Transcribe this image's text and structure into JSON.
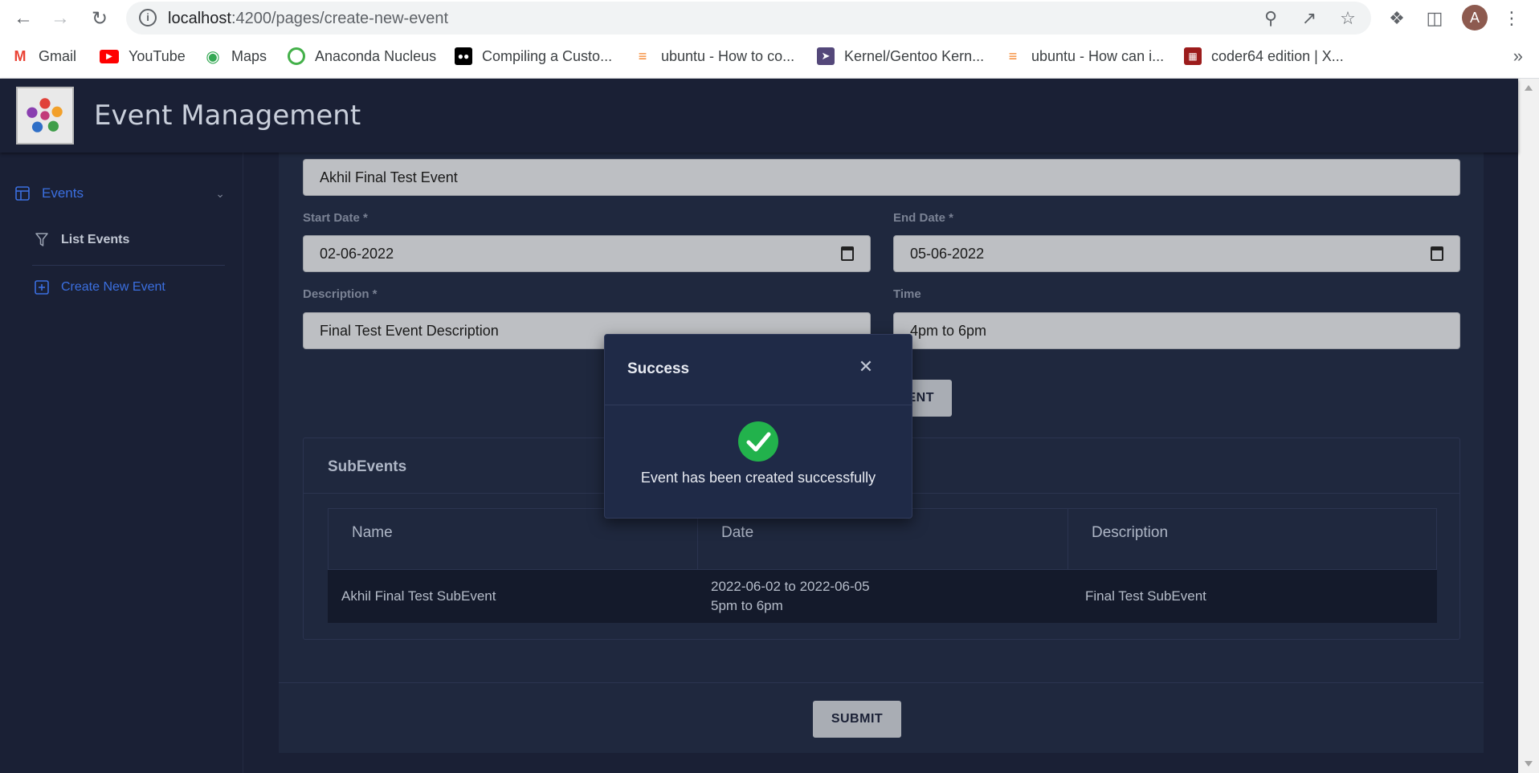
{
  "browser": {
    "url_host": "localhost",
    "url_path": ":4200/pages/create-new-event",
    "avatar_letter": "A",
    "bookmarks": [
      {
        "label": "Gmail",
        "icon": "gmail-icon",
        "color": "#ea4335"
      },
      {
        "label": "YouTube",
        "icon": "youtube-icon",
        "color": "#ff0000"
      },
      {
        "label": "Maps",
        "icon": "maps-icon",
        "color": "#34a853"
      },
      {
        "label": "Anaconda Nucleus",
        "icon": "anaconda-icon",
        "color": "#43b049"
      },
      {
        "label": "Compiling a Custo...",
        "icon": "medium-icon",
        "color": "#000000"
      },
      {
        "label": "ubuntu - How to co...",
        "icon": "stackexchange-icon",
        "color": "#f48024"
      },
      {
        "label": "Kernel/Gentoo Kern...",
        "icon": "gentoo-icon",
        "color": "#54487a"
      },
      {
        "label": "ubuntu - How can i...",
        "icon": "stackexchange-icon",
        "color": "#f48024"
      },
      {
        "label": "coder64 edition | X...",
        "icon": "coder64-icon",
        "color": "#9c1c1c"
      }
    ]
  },
  "app": {
    "title": "Event Management"
  },
  "sidebar": {
    "items": [
      {
        "label": "Events",
        "icon": "layout-icon",
        "color": "#3b6fe0"
      },
      {
        "label": "List Events",
        "icon": "filter-icon",
        "color": "#b8bfcc"
      },
      {
        "label": "Create New Event",
        "icon": "plus-square-icon",
        "color": "#3b6fe0"
      }
    ]
  },
  "form": {
    "event_name_value": "Akhil Final Test Event",
    "start_date_label": "Start Date *",
    "start_date_value": "02-06-2022",
    "end_date_label": "End Date *",
    "end_date_value": "05-06-2022",
    "description_label": "Description *",
    "description_value": "Final Test Event Description",
    "time_label": "Time",
    "time_value": "4pm to 6pm",
    "add_subevent_partial": "ENT",
    "submit_label": "SUBMIT"
  },
  "subevents": {
    "title": "SubEvents",
    "columns": [
      "Name",
      "Date",
      "Description"
    ],
    "rows": [
      {
        "name": "Akhil Final Test SubEvent",
        "date_line1": "2022-06-02 to 2022-06-05",
        "date_line2": "5pm to 6pm",
        "description": "Final Test SubEvent"
      }
    ]
  },
  "modal": {
    "title": "Success",
    "message": "Event has been created successfully",
    "icon": "check-circle-icon",
    "accent": "#22b24c"
  }
}
